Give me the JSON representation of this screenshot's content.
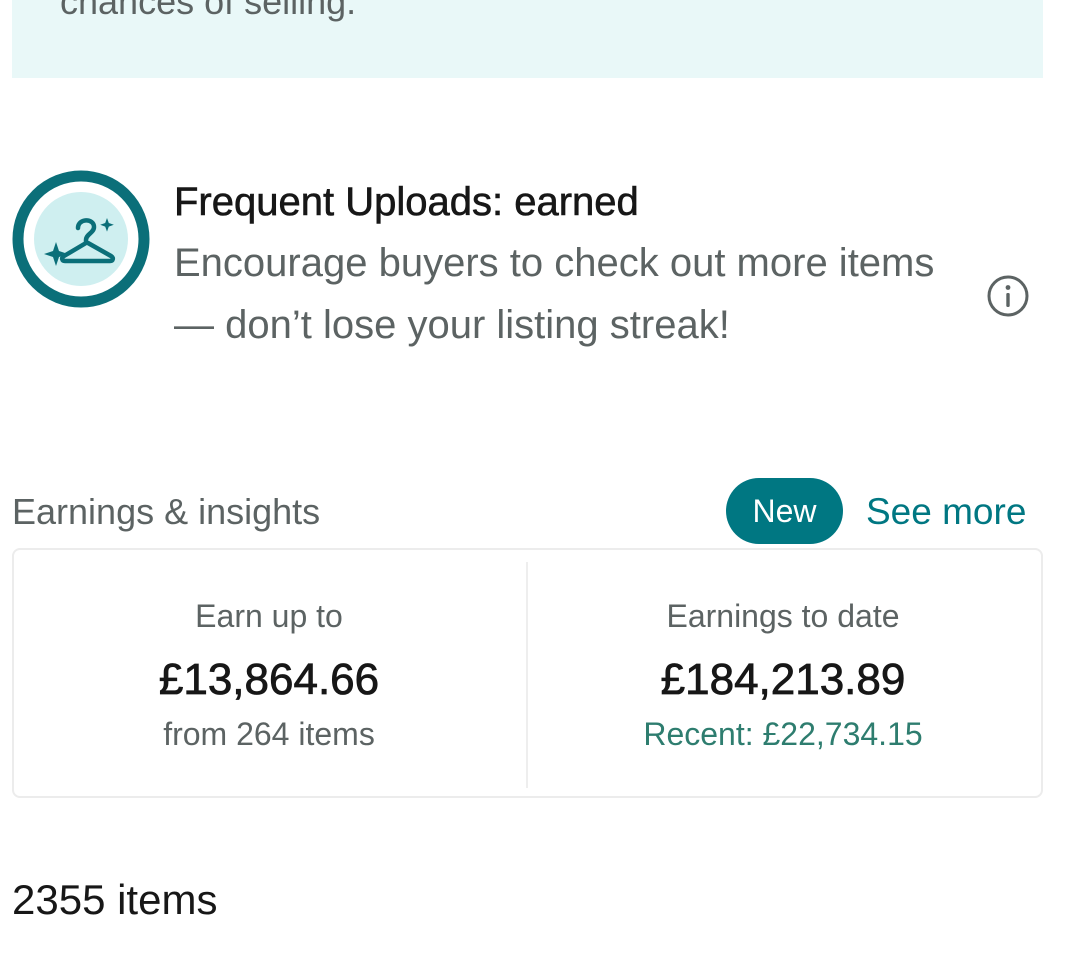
{
  "tip_banner": {
    "text": "chances of selling."
  },
  "badge": {
    "icon": "hanger-sparkle-icon",
    "title": "Frequent Uploads: earned",
    "description": "Encourage buyers to check out more items — don’t lose your listing streak!",
    "info_icon": "info-icon"
  },
  "earnings": {
    "section_title": "Earnings & insights",
    "new_badge": "New",
    "see_more_label": "See more",
    "left": {
      "label": "Earn up to",
      "value": "£13,864.66",
      "sub": "from 264 items"
    },
    "right": {
      "label": "Earnings to date",
      "value": "£184,213.89",
      "sub": "Recent: £22,734.15"
    }
  },
  "items": {
    "count_label": "2355 items"
  },
  "colors": {
    "accent": "#007782",
    "banner_bg": "#e9f8f8",
    "recent_green": "#2e7d6f"
  }
}
